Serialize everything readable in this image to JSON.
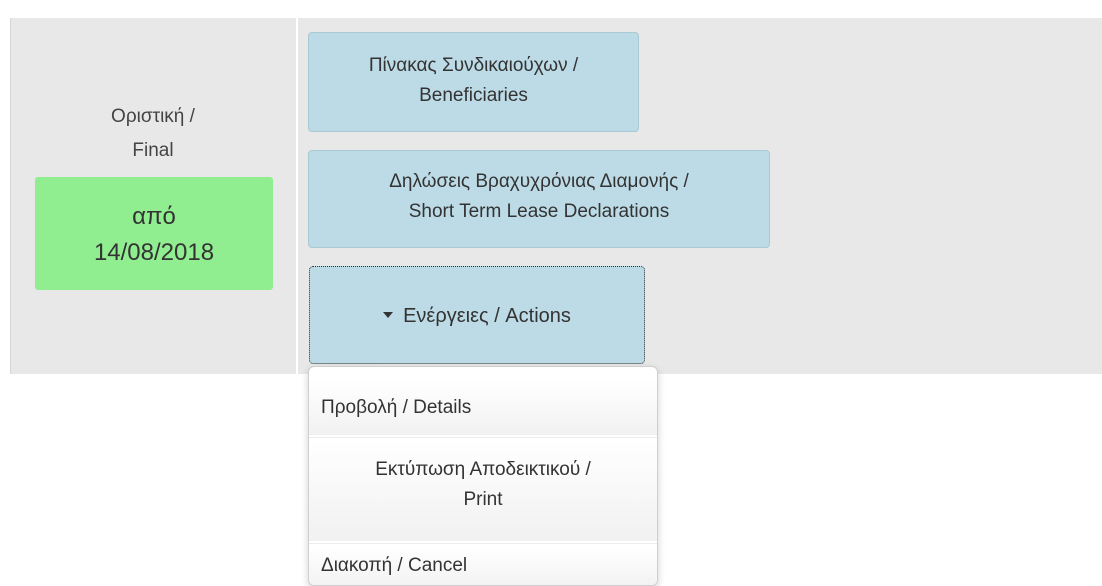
{
  "status": {
    "label_line1": "Οριστική /",
    "label_line2": "Final",
    "badge_line1": "από",
    "badge_line2": "14/08/2018",
    "badge_color": "#90ee90"
  },
  "buttons": {
    "beneficiaries_line1": "Πίνακας Συνδικαιούχων /",
    "beneficiaries_line2": "Beneficiaries",
    "lease_line1": "Δηλώσεις Βραχυχρόνιας Διαμονής /",
    "lease_line2": "Short Term Lease Declarations",
    "actions_label": "Ενέργειες /  Actions",
    "button_color": "#bddbe6"
  },
  "dropdown": {
    "items": [
      {
        "line1": "Προβολή / Details"
      },
      {
        "line1": "Εκτύπωση Αποδεικτικού /",
        "line2": "Print"
      },
      {
        "line1": "Διακοπή /  Cancel"
      }
    ]
  },
  "icons": {
    "actions_caret": "caret-down-icon"
  }
}
